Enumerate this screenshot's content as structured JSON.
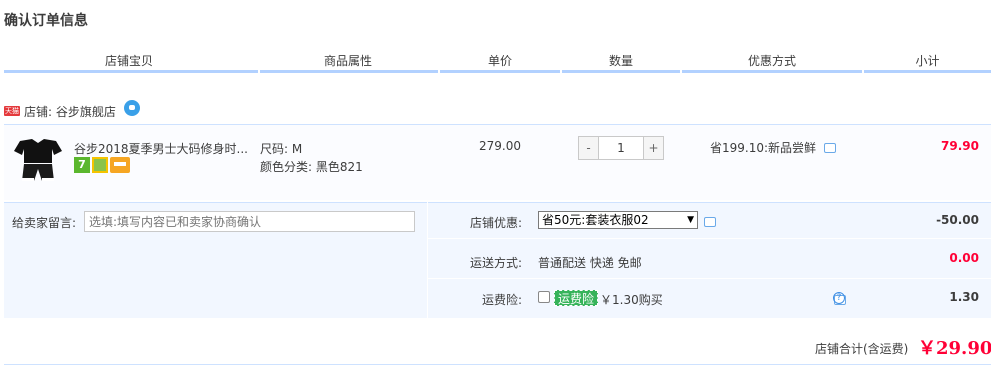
{
  "page": {
    "title": "确认订单信息"
  },
  "columns": [
    "店铺宝贝",
    "商品属性",
    "单价",
    "数量",
    "优惠方式",
    "小计"
  ],
  "shop": {
    "label": "店铺: 谷步旗舰店",
    "badge": "天猫"
  },
  "item": {
    "title": "谷步2018夏季男士大码修身时...",
    "badge_7": "7",
    "attr_size": "尺码: M",
    "attr_color": "颜色分类: 黑色821",
    "price": "279.00",
    "qty_minus": "-",
    "qty_value": "1",
    "qty_plus": "+",
    "promo": "省199.10:新品尝鲜",
    "subtotal": "79.90"
  },
  "message": {
    "label": "给卖家留言:",
    "placeholder": "选填:填写内容已和卖家协商确认"
  },
  "shop_discount": {
    "label": "店铺优惠:",
    "selected": "省50元:套装衣服02",
    "value": "-50.00"
  },
  "shipping": {
    "label": "运送方式:",
    "method": "普通配送 快递 免邮",
    "value": "0.00"
  },
  "insurance": {
    "label": "运费险:",
    "badge": "运费险",
    "price_text": "￥1.30购买",
    "value": "1.30"
  },
  "total": {
    "label": "店铺合计(含运费)",
    "amount": "￥29.90"
  },
  "colors": {
    "accent_red": "#ff0036",
    "header_line": "#b2d1ff",
    "panel_bg": "#f2f7ff",
    "insurance_green": "#36b35a"
  }
}
